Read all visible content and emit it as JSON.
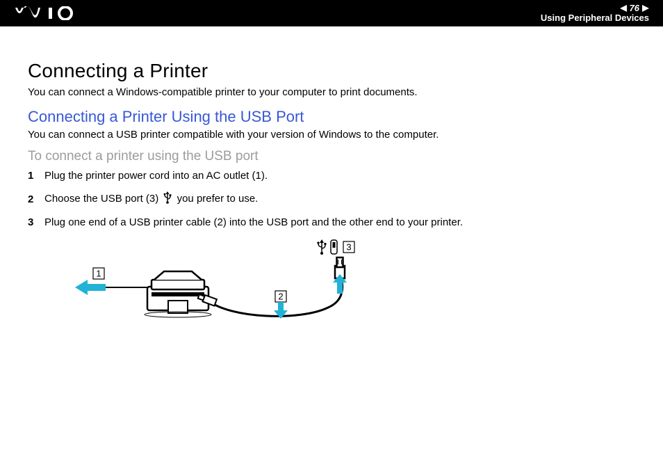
{
  "header": {
    "page_number": "76",
    "section": "Using Peripheral Devices"
  },
  "page": {
    "title": "Connecting a Printer",
    "intro": "You can connect a Windows-compatible printer to your computer to print documents.",
    "subtitle_blue": "Connecting a Printer Using the USB Port",
    "sub_intro": "You can connect a USB printer compatible with your version of Windows to the computer.",
    "subtitle_grey": "To connect a printer using the USB port",
    "steps": [
      "Plug the printer power cord into an AC outlet (1).",
      "Choose the USB port (3)      you prefer to use.",
      "Plug one end of a USB printer cable (2) into the USB port and the other end to your printer."
    ]
  },
  "diagram": {
    "callouts": [
      "1",
      "2",
      "3"
    ]
  }
}
